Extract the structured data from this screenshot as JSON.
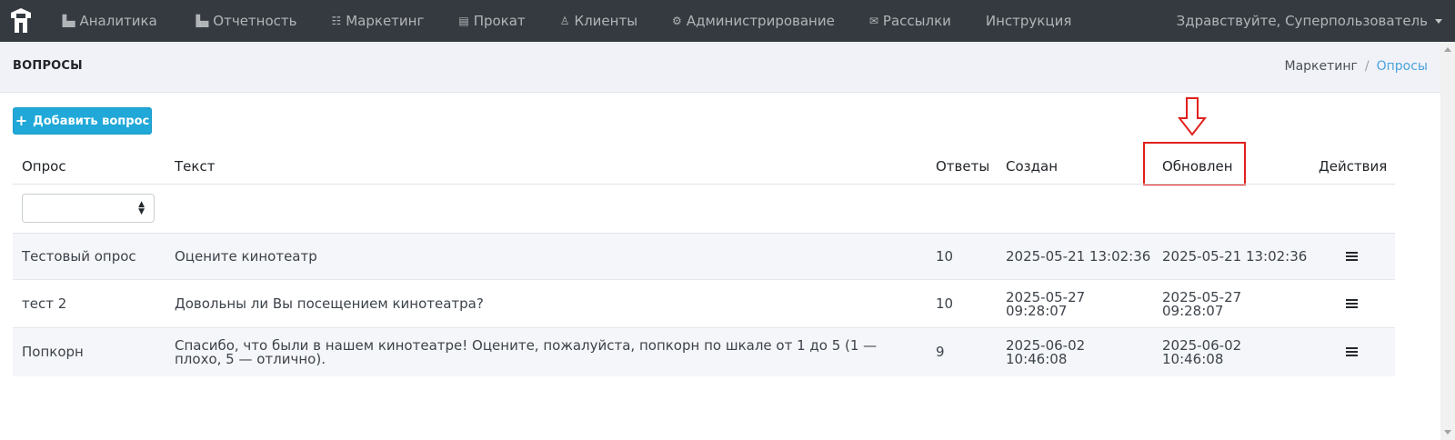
{
  "nav": {
    "items": [
      {
        "icon": "bar-chart-icon",
        "glyph": "▐▄",
        "label": "Аналитика"
      },
      {
        "icon": "bar-chart-icon",
        "glyph": "▐▄",
        "label": "Отчетность"
      },
      {
        "icon": "cart-icon",
        "glyph": "☷",
        "label": "Маркетинг"
      },
      {
        "icon": "film-icon",
        "glyph": "▤",
        "label": "Прокат"
      },
      {
        "icon": "user-icon",
        "glyph": "♙",
        "label": "Клиенты"
      },
      {
        "icon": "gears-icon",
        "glyph": "⚙",
        "label": "Администрирование"
      },
      {
        "icon": "envelope-icon",
        "glyph": "✉",
        "label": "Рассылки"
      },
      {
        "icon": "",
        "glyph": "",
        "label": "Инструкция"
      }
    ],
    "user_greeting": "Здравствуйте, Суперпользователь"
  },
  "page": {
    "title": "ВОПРОСЫ",
    "breadcrumb": {
      "parent": "Маркетинг",
      "separator": "/",
      "current": "Опросы"
    }
  },
  "toolbar": {
    "add_button_label": "Добавить вопрос"
  },
  "table": {
    "columns": [
      "Опрос",
      "Текст",
      "Ответы",
      "Создан",
      "Обновлен",
      "Действия"
    ],
    "filter_value": "",
    "rows": [
      {
        "survey": "Тестовый опрос",
        "text": "Оцените кинотеатр",
        "answers": "10",
        "created": "2025-05-21 13:02:36",
        "updated": "2025-05-21 13:02:36"
      },
      {
        "survey": "тест 2",
        "text": "Довольны ли Вы посещением кинотеатра?",
        "answers": "10",
        "created": "2025-05-27 09:28:07",
        "updated": "2025-05-27 09:28:07"
      },
      {
        "survey": "Попкорн",
        "text": "Спасибо, что были в нашем кинотеатре! Оцените, пожалуйста, попкорн по шкале от 1 до 5 (1 — плохо, 5 — отлично).",
        "answers": "9",
        "created": "2025-06-02 10:46:08",
        "updated": "2025-06-02 10:46:08"
      }
    ]
  },
  "colors": {
    "navbar": "#343a40",
    "primary": "#20a8d8",
    "annotation": "#e0201c",
    "link": "#4aa3df"
  }
}
